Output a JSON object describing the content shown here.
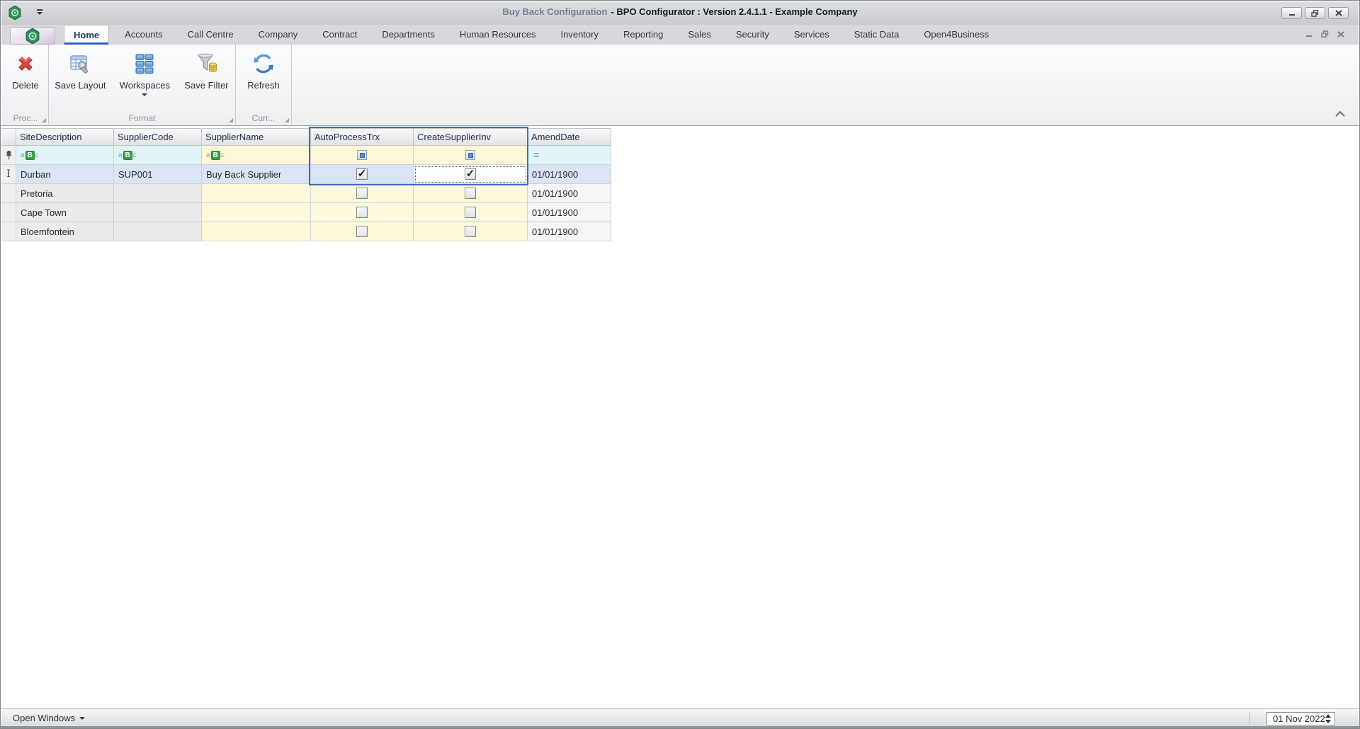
{
  "titlebar": {
    "title_document": "Buy Back Configuration",
    "title_app": "- BPO Configurator : Version 2.4.1.1 - Example Company"
  },
  "ribbon": {
    "tabs": [
      "Home",
      "Accounts",
      "Call Centre",
      "Company",
      "Contract",
      "Departments",
      "Human Resources",
      "Inventory",
      "Reporting",
      "Sales",
      "Security",
      "Services",
      "Static Data",
      "Open4Business"
    ],
    "active_tab": "Home",
    "buttons": {
      "delete": "Delete",
      "save_layout": "Save Layout",
      "workspaces": "Workspaces",
      "save_filter": "Save Filter",
      "refresh": "Refresh"
    },
    "groups": {
      "processing": "Proc...",
      "format": "Format",
      "current": "Curr..."
    }
  },
  "grid": {
    "columns": [
      "SiteDescription",
      "SupplierCode",
      "SupplierName",
      "AutoProcessTrx",
      "CreateSupplierInv",
      "AmendDate"
    ],
    "rows": [
      {
        "SiteDescription": "Durban",
        "SupplierCode": "SUP001",
        "SupplierName": "Buy Back Supplier",
        "AutoProcessTrx": true,
        "CreateSupplierInv": true,
        "AmendDate": "01/01/1900"
      },
      {
        "SiteDescription": "Pretoria",
        "SupplierCode": "",
        "SupplierName": "",
        "AutoProcessTrx": false,
        "CreateSupplierInv": false,
        "AmendDate": "01/01/1900"
      },
      {
        "SiteDescription": "Cape Town",
        "SupplierCode": "",
        "SupplierName": "",
        "AutoProcessTrx": false,
        "CreateSupplierInv": false,
        "AmendDate": "01/01/1900"
      },
      {
        "SiteDescription": "Bloemfontein",
        "SupplierCode": "",
        "SupplierName": "",
        "AutoProcessTrx": false,
        "CreateSupplierInv": false,
        "AmendDate": "01/01/1900"
      }
    ]
  },
  "statusbar": {
    "open_windows": "Open Windows",
    "date": "01 Nov 2022"
  },
  "icons": {
    "checkmark": "✓",
    "ibeam": "I",
    "equals": "=",
    "abc_a": "a",
    "abc_b": "B",
    "abc_c": "c"
  },
  "colors": {
    "selection_blue": "#3c6cc3",
    "selected_row": "#dae4f7",
    "filter_cyan": "#e1f5f8",
    "cell_yellow": "#fdf9dc",
    "readonly_gray": "#ebebec",
    "logo_green": "#2f9058",
    "delete_red": "#cc3b2f"
  }
}
